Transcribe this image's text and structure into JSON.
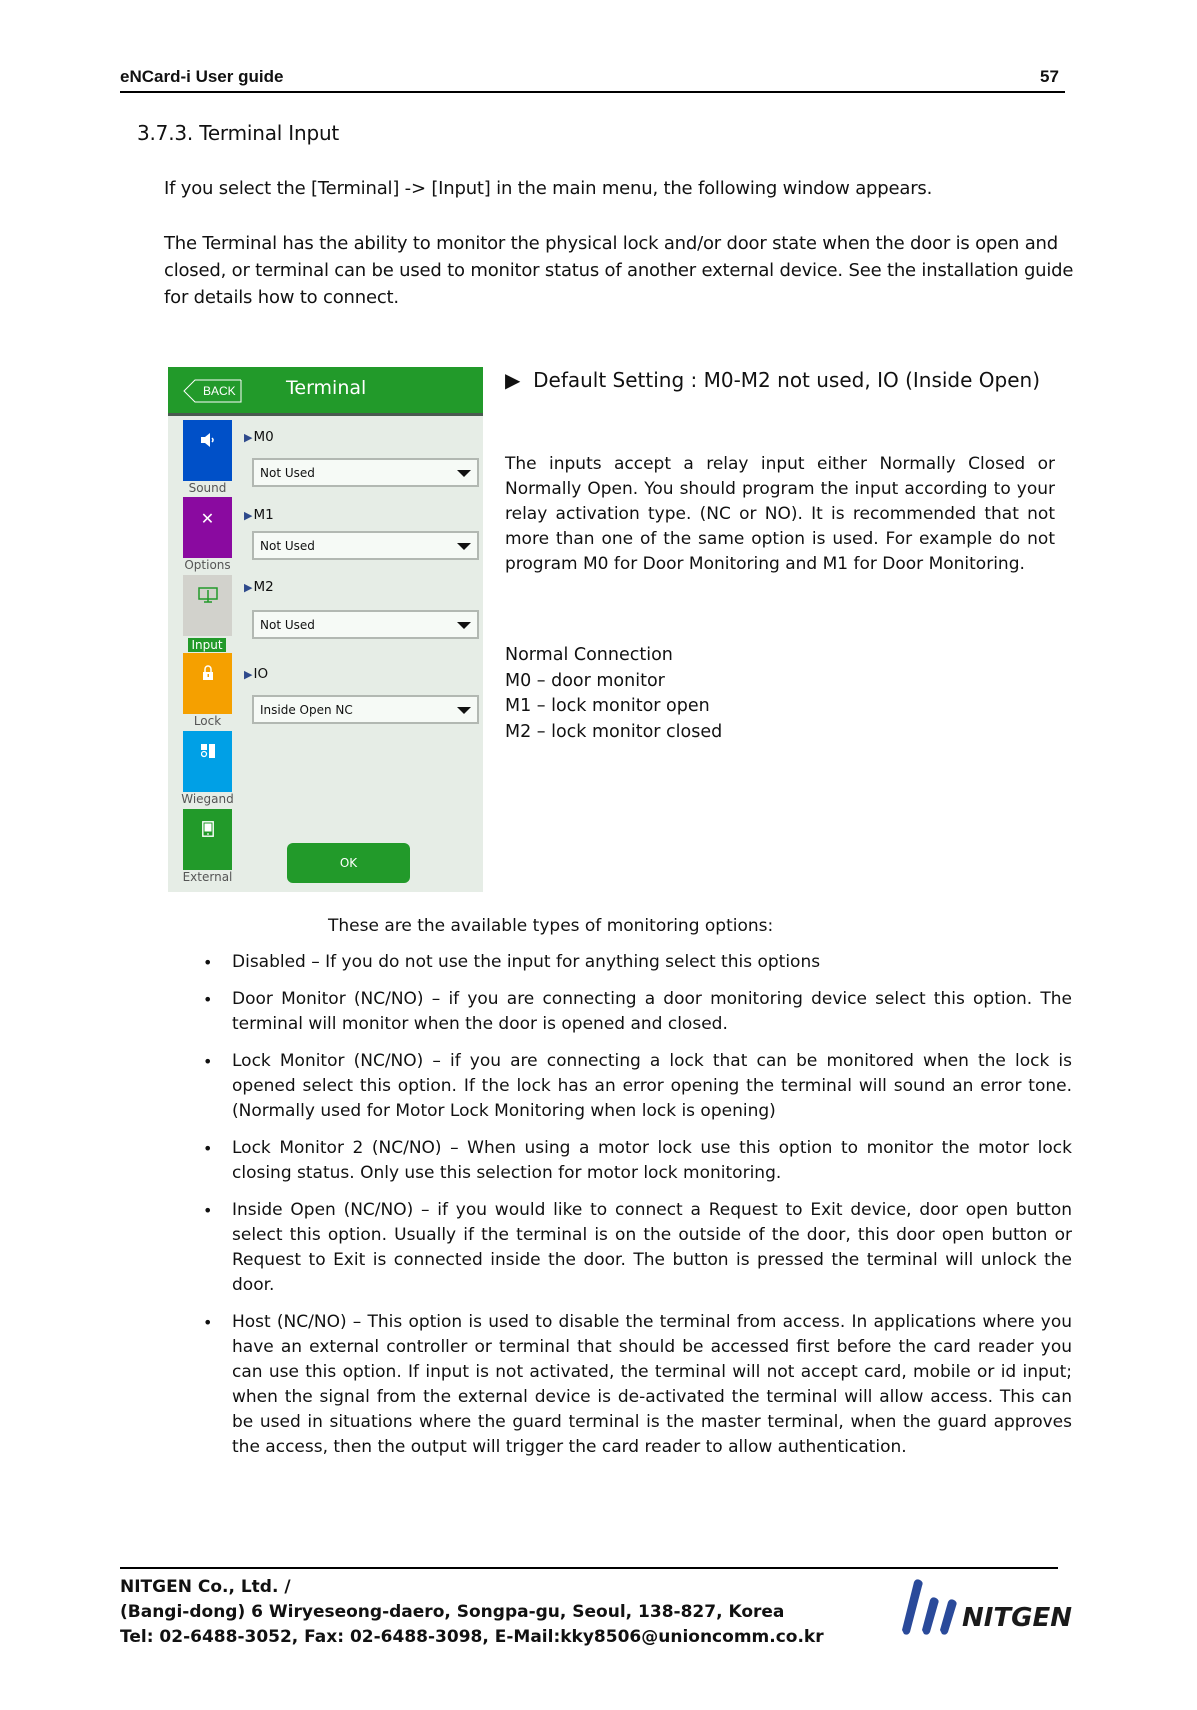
{
  "header": {
    "title": "eNCard-i User guide",
    "page_number": "57"
  },
  "section": {
    "title": "3.7.3. Terminal Input",
    "intro_1": "If you select the [Terminal] -> [Input] in the main menu, the following window appears.",
    "intro_2": "The Terminal has the ability to monitor the physical lock and/or door state when the door is open and closed, or terminal can be used to monitor status of another external device. See the installation guide for details how to connect."
  },
  "terminal": {
    "back_label": "BACK",
    "title": "Terminal",
    "sidebar": [
      {
        "label": "Sound",
        "icon": "speaker-icon",
        "color": "#0050c8",
        "active": false
      },
      {
        "label": "Options",
        "icon": "tools-icon",
        "color": "#8a0aa0",
        "active": false
      },
      {
        "label": "Input",
        "icon": "input-monitor-icon",
        "color": "#d2d2cc",
        "active": true
      },
      {
        "label": "Lock",
        "icon": "lock-icon",
        "color": "#f5a000",
        "active": false
      },
      {
        "label": "Wiegand",
        "icon": "wiegand-icon",
        "color": "#00a0e6",
        "active": false
      },
      {
        "label": "External",
        "icon": "tablet-icon",
        "color": "#229a2a",
        "active": false
      }
    ],
    "fields": [
      {
        "label": "M0",
        "value": "Not Used"
      },
      {
        "label": "M1",
        "value": "Not Used"
      },
      {
        "label": "M2",
        "value": "Not Used"
      },
      {
        "label": "IO",
        "value": "Inside Open NC"
      }
    ],
    "ok_label": "OK",
    "accent_color": "#229a2a"
  },
  "right_column": {
    "default_marker": "▶",
    "default_setting": "Default Setting : M0-M2 not used, IO (Inside Open)",
    "description": "The inputs accept a relay input either Normally Closed or Normally Open. You should program the input according to your relay activation type. (NC or NO). It is recommended that not more than one of the same option is used. For example do not program M0 for Door Monitoring and M1 for Door Monitoring.",
    "connection_title": "Normal Connection",
    "connections": [
      "M0 – door monitor",
      "M1 – lock monitor open",
      "M2 – lock monitor closed"
    ]
  },
  "options": {
    "intro": "These are the available types of monitoring options:",
    "items": [
      "Disabled – If you do not use the input for anything select this options",
      "Door Monitor (NC/NO) – if you are connecting a door monitoring device select this option. The terminal will monitor when the door is opened and closed.",
      "Lock Monitor (NC/NO) – if you are connecting a lock that can be monitored when the lock is opened select this option. If the lock has an error opening the terminal will sound an error tone. (Normally used for Motor Lock Monitoring when lock is opening)",
      "Lock Monitor 2 (NC/NO) – When using a motor lock use this option to monitor the motor lock closing status. Only use this selection for motor lock monitoring.",
      "Inside Open (NC/NO) – if you would like to connect a Request to Exit device, door open button select this option. Usually if the terminal is on the outside of the door, this door open button or Request to Exit is connected inside the door. The button is pressed the terminal will unlock the door.",
      "Host (NC/NO) – This option is used to disable the terminal from access. In applications where you have an external controller or terminal that should be accessed first before the card reader you can use this option. If input is not activated, the terminal will not accept card, mobile or id input; when the signal from the external device is de-activated the terminal will allow access. This can be used in situations where the guard terminal is the master terminal, when the guard approves the access, then the output will trigger the card reader to allow authentication."
    ]
  },
  "footer": {
    "line_1": "NITGEN Co., Ltd. /",
    "line_2": "(Bangi-dong) 6 Wiryeseong-daero, Songpa-gu, Seoul, 138-827, Korea",
    "line_3": "Tel: 02-6488-3052, Fax: 02-6488-3098, E-Mail:kky8506@unioncomm.co.kr",
    "logo_text": "NITGEN",
    "logo_color": "#2a4a9a"
  }
}
